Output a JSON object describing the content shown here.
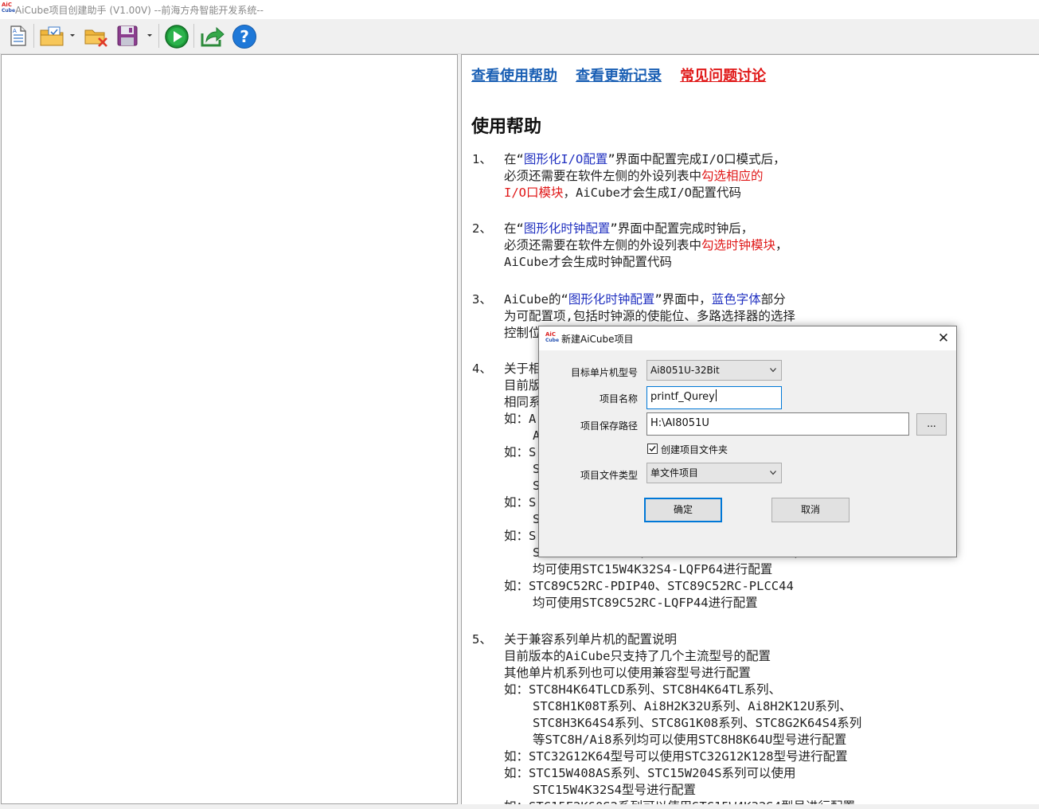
{
  "window": {
    "title": "AiCube项目创建助手 (V1.00V) --前海方舟智能开发系统--",
    "icon_text": "AiC",
    "icon_sub": "Cube"
  },
  "toolbar": {
    "buttons": [
      {
        "name": "new-document-icon"
      },
      {
        "name": "open-folder-icon"
      },
      {
        "name": "close-project-icon"
      },
      {
        "name": "save-icon"
      },
      {
        "name": "run-icon"
      },
      {
        "name": "export-icon"
      },
      {
        "name": "help-icon"
      }
    ]
  },
  "help": {
    "links": [
      {
        "label": "查看使用帮助",
        "color": "#1a5fb4"
      },
      {
        "label": "查看更新记录",
        "color": "#1a5fb4"
      },
      {
        "label": "常见问题讨论",
        "color": "#e01818"
      }
    ],
    "title": "使用帮助",
    "s1": {
      "num": "1、",
      "l1a": "在“",
      "l1b": "图形化I/O配置",
      "l1c": "”界面中配置完成I/O口模式后，",
      "l2a": "必须还需要在软件左侧的外设列表中",
      "l2b": "勾选相应的",
      "l3a": "I/O口模块",
      "l3b": "，AiCube才会生成I/O配置代码"
    },
    "s2": {
      "num": "2、",
      "l1a": "在“",
      "l1b": "图形化时钟配置",
      "l1c": "”界面中配置完成时钟后，",
      "l2a": "必须还需要在软件左侧的外设列表中",
      "l2b": "勾选时钟模块",
      "l2c": "，",
      "l3": "AiCube才会生成时钟配置代码"
    },
    "s3": {
      "num": "3、",
      "l1a": "AiCube的“",
      "l1b": "图形化时钟配置",
      "l1c": "”界面中，",
      "l1d": "蓝色字体",
      "l1e": "部分",
      "l2": "为可配置项,包括时钟源的使能位、多路选择器的选择",
      "l3": "控制位"
    },
    "s4": {
      "num": "4、",
      "l1": "关于相",
      "l2": "目前版",
      "l3": "相同系",
      "l4": "如：A",
      "l5": "A",
      "l6": "如：S",
      "l7": "S",
      "l8": "S",
      "l9": "如：S",
      "l10": "S",
      "l11": "如：S",
      "l12": "STC15W4K32S4-LQFP44、STC15W4K32S4-LQFP48",
      "l13": "均可使用STC15W4K32S4-LQFP64进行配置",
      "l14": "如：STC89C52RC-PDIP40、STC89C52RC-PLCC44",
      "l15": "均可使用STC89C52RC-LQFP44进行配置"
    },
    "s5": {
      "num": "5、",
      "l1": "关于兼容系列单片机的配置说明",
      "l2": "目前版本的AiCube只支持了几个主流型号的配置",
      "l3": "其他单片机系列也可以使用兼容型号进行配置",
      "l4": "如：STC8H4K64TLCD系列、STC8H4K64TL系列、",
      "l5": "STC8H1K08T系列、Ai8H2K32U系列、Ai8H2K12U系列、",
      "l6": "STC8H3K64S4系列、STC8G1K08系列、STC8G2K64S4系列",
      "l7": "等STC8H/Ai8系列均可以使用STC8H8K64U型号进行配置",
      "l8": "如：STC32G12K64型号可以使用STC32G12K128型号进行配置",
      "l9": "如：STC15W408AS系列、STC15W204S系列可以使用",
      "l10": "STC15W4K32S4型号进行配置",
      "l11": "如：STC15F2K60S2系列可以使用STC15W4K32S4型号进行配置"
    }
  },
  "dialog": {
    "title": "新建AiCube项目",
    "close": "✕",
    "chip_label": "目标单片机型号",
    "chip_value": "Ai8051U-32Bit",
    "name_label": "项目名称",
    "name_value": "printf_Qurey",
    "path_label": "项目保存路径",
    "path_value": "H:\\AI8051U",
    "browse": "...",
    "create_folder_label": "创建项目文件夹",
    "create_folder_checked": true,
    "type_label": "项目文件类型",
    "type_value": "单文件项目",
    "ok": "确定",
    "cancel": "取消",
    "accent": "#0078d7"
  }
}
